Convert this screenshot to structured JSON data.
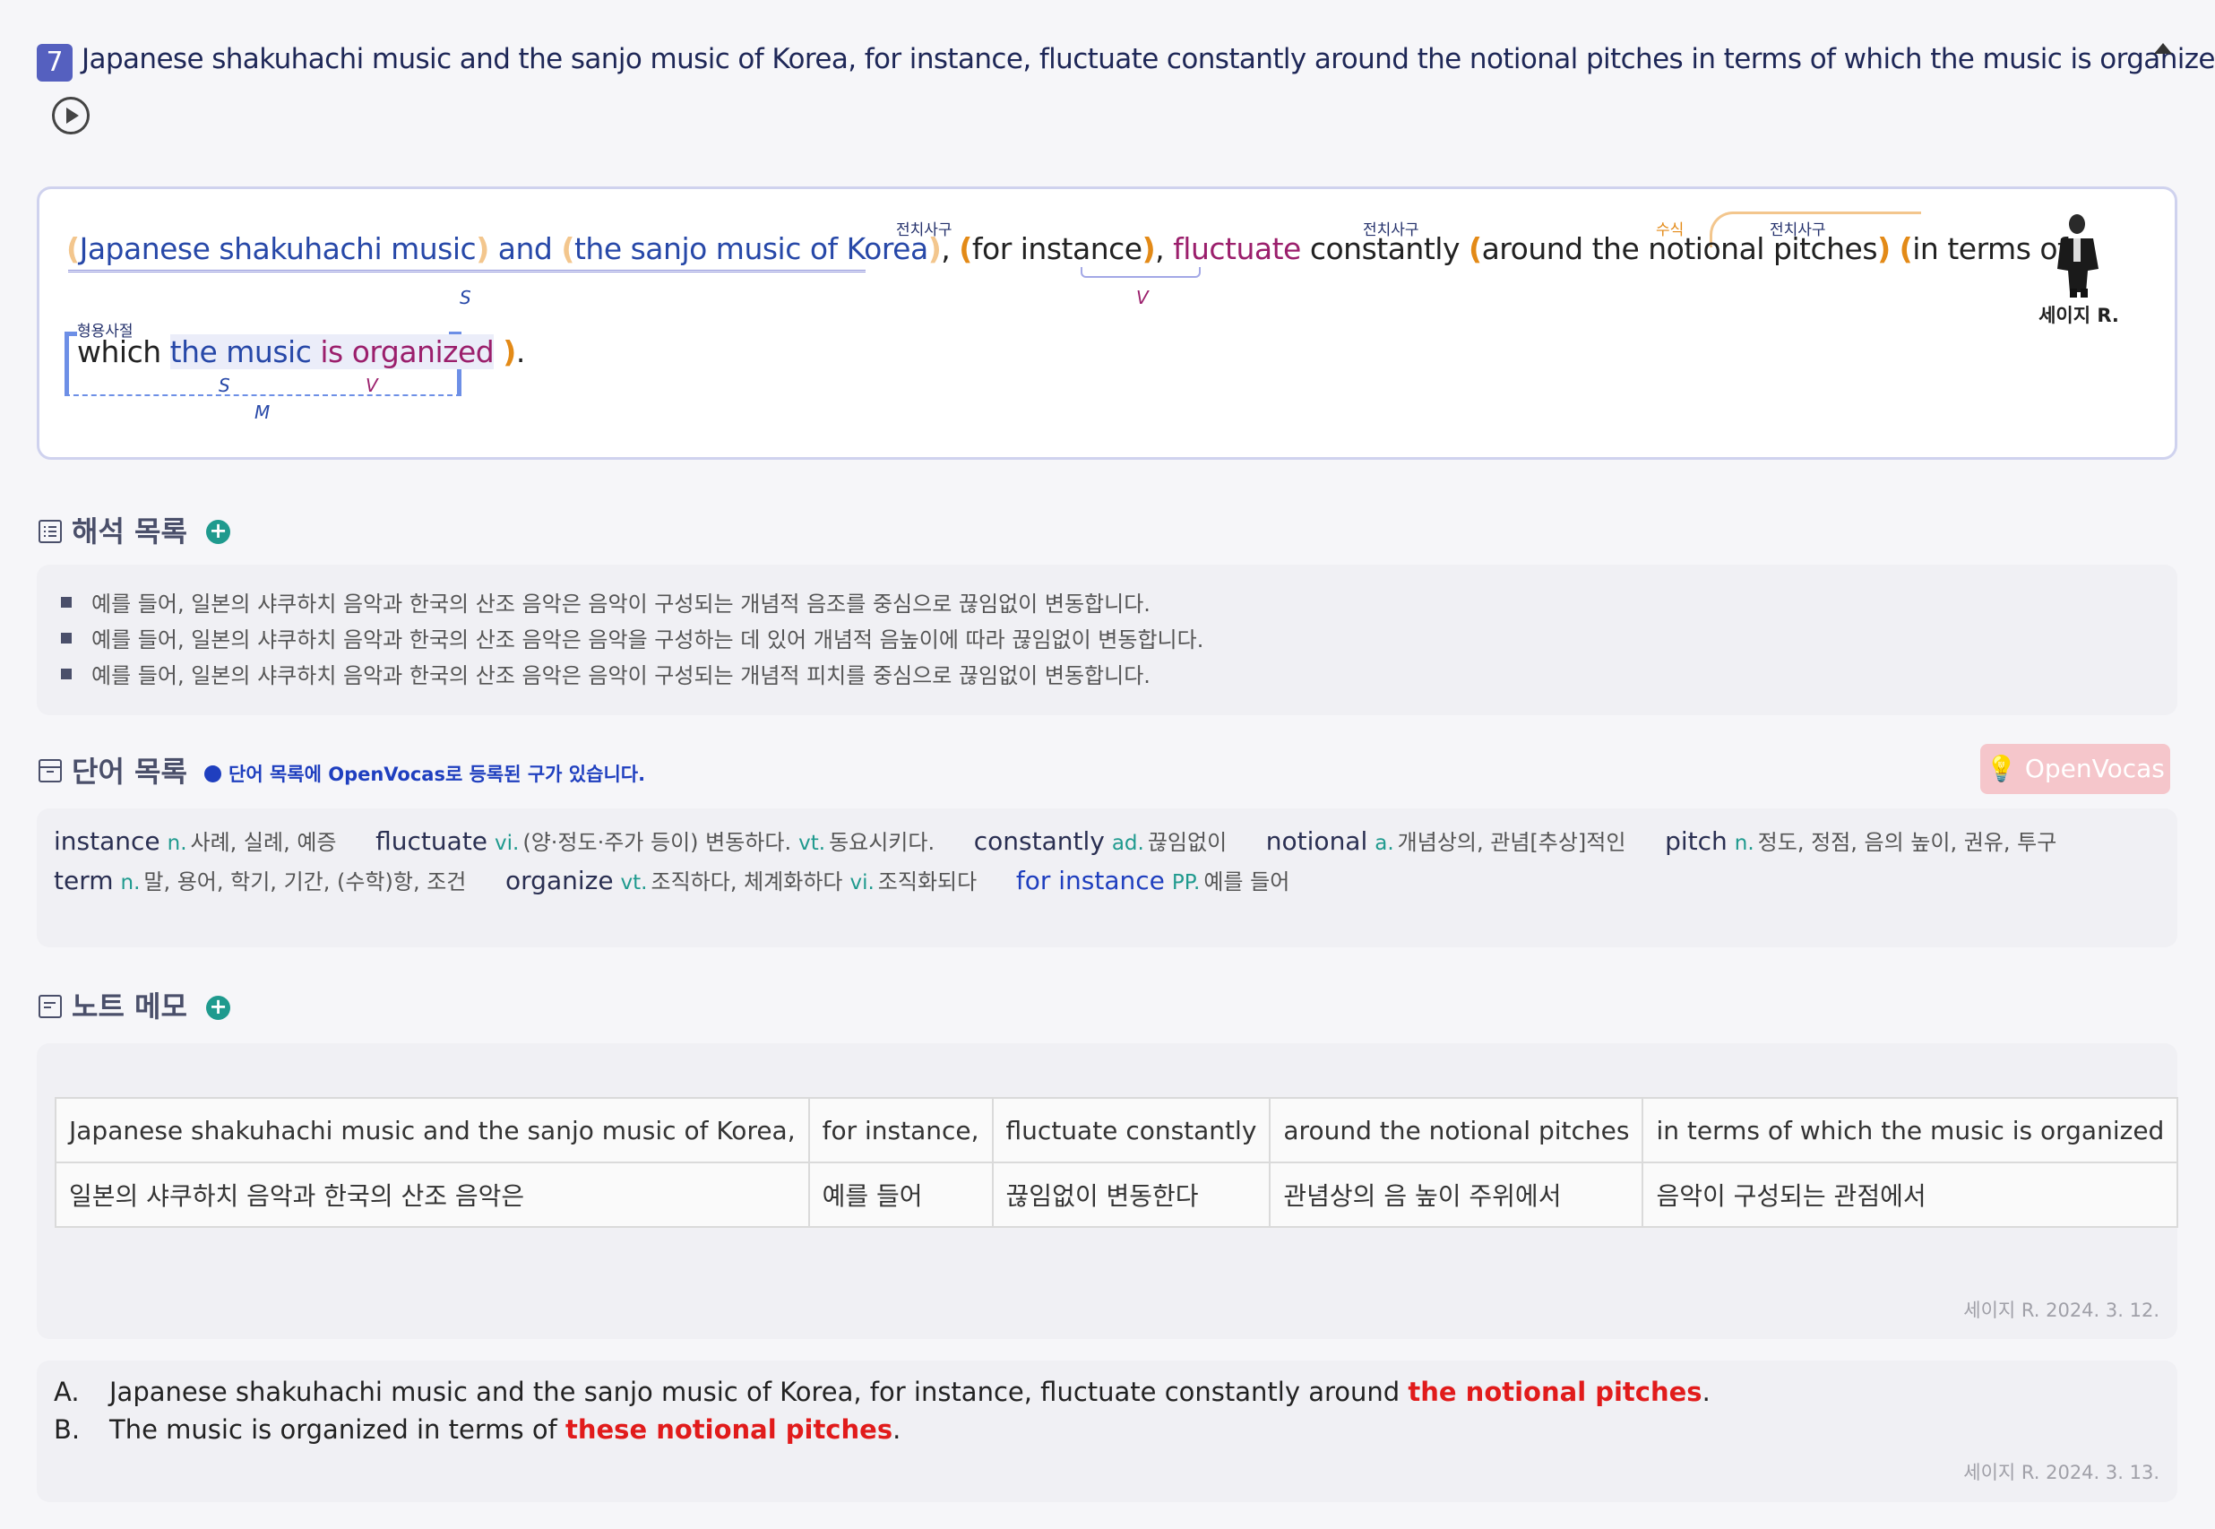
{
  "header": {
    "number": "7",
    "sentence": "Japanese shakuhachi music and the sanjo music of Korea, for instance, fluctuate constantly around the notional pitches in terms of which the music is organized."
  },
  "analysis": {
    "line1": {
      "subj1": "Japanese shakuhachi music",
      "and": "and",
      "subj2": "the sanjo music of Korea",
      "comma1": ",",
      "pp1": "for instance",
      "comma2": ",",
      "verb": "fluctuate",
      "adv": "constantly",
      "pp2": "around the notional pitches",
      "pp3": "in terms of"
    },
    "line2": {
      "which": "which",
      "subj": "the music",
      "verb": "is organized",
      "end": "."
    },
    "tags": {
      "pp1": "전치사구",
      "pp2": "전치사구",
      "modifier": "수식",
      "pp3": "전치사구",
      "adj_clause": "형용사절"
    },
    "roles": {
      "s_main": "S",
      "v_main": "V",
      "s_clause": "S",
      "v_clause": "V",
      "m_clause": "M"
    },
    "author": "세이지 R."
  },
  "interpretations": {
    "title": "해석 목록",
    "items": [
      "예를 들어, 일본의 샤쿠하치 음악과 한국의 산조 음악은 음악이 구성되는 개념적 음조를 중심으로 끊임없이 변동합니다.",
      "예를 들어, 일본의 샤쿠하치 음악과 한국의 산조 음악은 음악을 구성하는 데 있어 개념적 음높이에 따라 끊임없이 변동합니다.",
      "예를 들어, 일본의 샤쿠하치 음악과 한국의 산조 음악은 음악이 구성되는 개념적 피치를 중심으로 끊임없이 변동합니다."
    ]
  },
  "vocab": {
    "title": "단어 목록",
    "notice": "단어 목록에 OpenVocas로 등록된 구가 있습니다.",
    "openvocas_button": "OpenVocas",
    "row1": [
      {
        "word": "instance",
        "entries": [
          {
            "pos": "n.",
            "def": "사례, 실례, 예증"
          }
        ]
      },
      {
        "word": "fluctuate",
        "entries": [
          {
            "pos": "vi.",
            "def": "(양·정도·주가 등이) 변동하다."
          },
          {
            "pos": "vt.",
            "def": "동요시키다."
          }
        ]
      },
      {
        "word": "constantly",
        "entries": [
          {
            "pos": "ad.",
            "def": "끊임없이"
          }
        ]
      },
      {
        "word": "notional",
        "entries": [
          {
            "pos": "a.",
            "def": "개념상의, 관념[추상]적인"
          }
        ]
      },
      {
        "word": "pitch",
        "entries": [
          {
            "pos": "n.",
            "def": "정도, 정점, 음의 높이, 권유, 투구"
          }
        ]
      }
    ],
    "row2": [
      {
        "word": "term",
        "entries": [
          {
            "pos": "n.",
            "def": "말, 용어, 학기, 기간, (수학)항, 조건"
          }
        ]
      },
      {
        "word": "organize",
        "entries": [
          {
            "pos": "vt.",
            "def": "조직하다, 체계화하다"
          },
          {
            "pos": "vi.",
            "def": "조직화되다"
          }
        ]
      },
      {
        "word": "for instance",
        "entries": [
          {
            "pos": "PP.",
            "def": "예를 들어"
          }
        ]
      }
    ]
  },
  "notes": {
    "title": "노트 메모",
    "table": {
      "row_en": [
        "Japanese shakuhachi music and the sanjo music of Korea,",
        "for instance,",
        "fluctuate constantly",
        "around the notional pitches",
        "in terms of which the music is organized"
      ],
      "row_ko": [
        "일본의 샤쿠하치 음악과 한국의 산조 음악은",
        "예를 들어",
        "끊임없이 변동한다",
        "관념상의 음 높이 주위에서",
        "음악이 구성되는 관점에서"
      ]
    },
    "stamp1": "세이지 R. 2024. 3. 12.",
    "memo": [
      {
        "label": "A.",
        "text": "Japanese shakuhachi music and the sanjo music of Korea, for instance, fluctuate constantly around ",
        "emph": "the notional pitches",
        "tail": "."
      },
      {
        "label": "B.",
        "text": "The music is organized in terms of ",
        "emph": "these notional pitches",
        "tail": "."
      }
    ],
    "stamp2": "세이지 R. 2024. 3. 13."
  },
  "colors": {
    "accent": "#5560bf",
    "subject": "#2748a8",
    "verb": "#9b1f6c",
    "paren": "#e38a17",
    "plus": "#1f9a8e",
    "emphasis": "#e11b1b"
  },
  "icons": {
    "play": "play-circle-icon",
    "collapse": "caret-up-icon",
    "interpretations": "list-icon",
    "vocab": "archive-icon",
    "notes": "note-icon",
    "add": "plus-circle-icon"
  }
}
